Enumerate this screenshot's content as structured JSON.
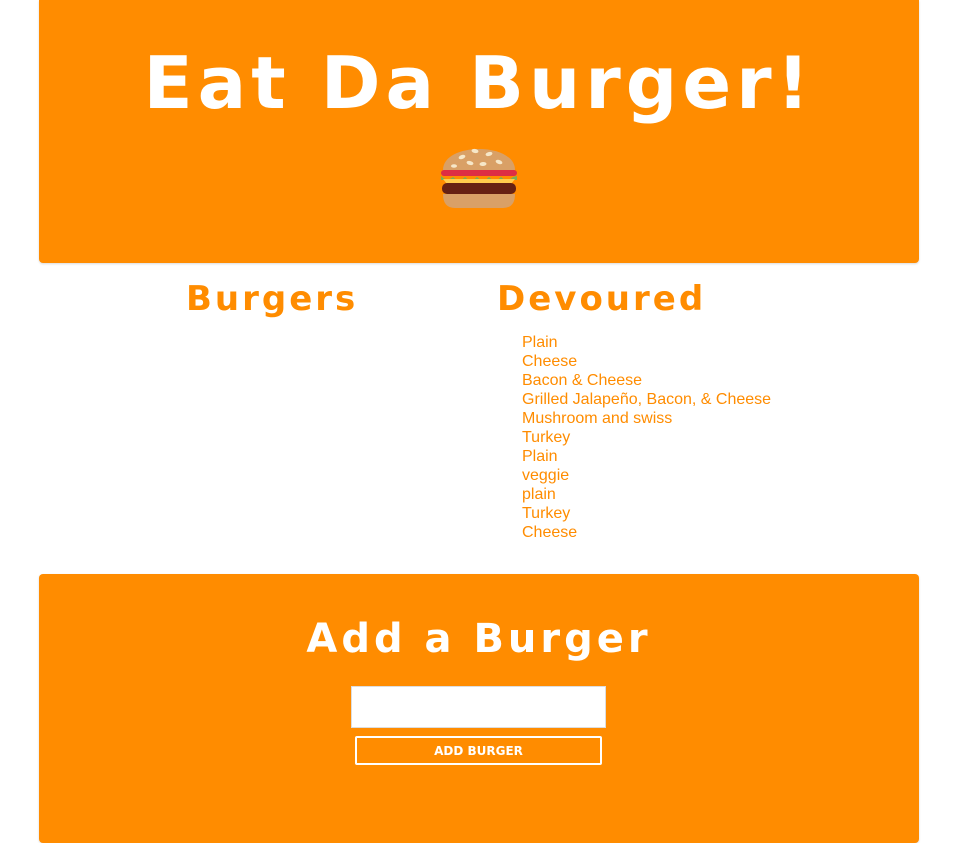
{
  "header": {
    "title": "Eat Da Burger!",
    "icon": "hamburger-icon"
  },
  "columns": {
    "burgers_title": "Burgers",
    "devoured_title": "Devoured",
    "burgers": [],
    "devoured": [
      "Plain",
      "Cheese",
      "Bacon & Cheese",
      "Grilled Jalapeño, Bacon, & Cheese",
      "Mushroom and swiss",
      "Turkey",
      "Plain",
      "veggie",
      "plain",
      "Turkey",
      "Cheese"
    ]
  },
  "add_form": {
    "title": "Add a Burger",
    "input_value": "",
    "input_placeholder": "",
    "button_label": "Add Burger"
  },
  "colors": {
    "accent": "#ff8c00",
    "text_on_accent": "#ffffff",
    "background": "#ffffff"
  }
}
